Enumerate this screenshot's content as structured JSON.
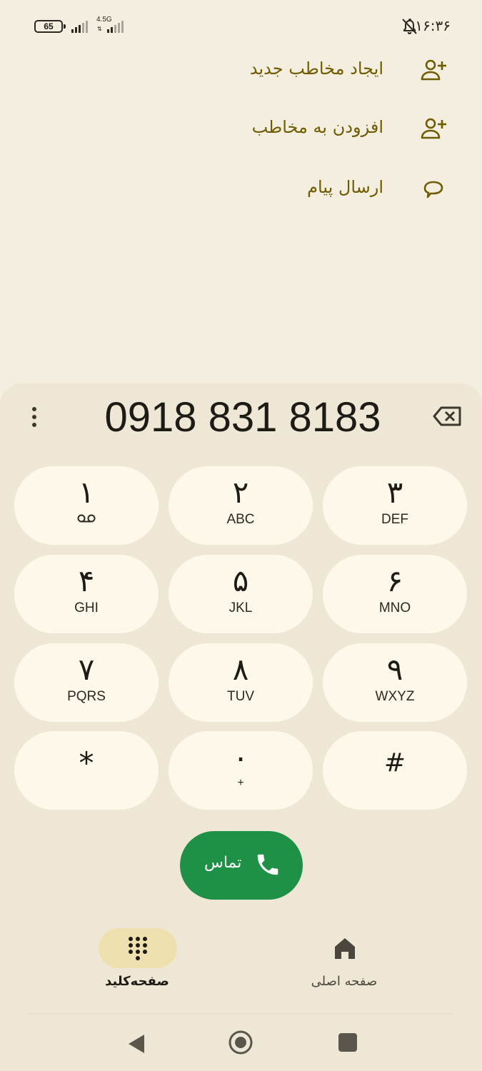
{
  "status_bar": {
    "battery": "65",
    "network": "4.5G",
    "time": "۱۶:۳۶",
    "icons": [
      "signal-icon",
      "signal-4g-icon",
      "bell-off-icon"
    ]
  },
  "actions": [
    {
      "label": "ایجاد مخاطب جدید",
      "icon": "person-add-icon"
    },
    {
      "label": "افزودن به مخاطب",
      "icon": "person-add-icon"
    },
    {
      "label": "ارسال پیام",
      "icon": "message-icon"
    }
  ],
  "dialer": {
    "number": "0918 831 8183"
  },
  "keys": [
    {
      "digit": "۱",
      "letters": ""
    },
    {
      "digit": "۲",
      "letters": "ABC"
    },
    {
      "digit": "۳",
      "letters": "DEF"
    },
    {
      "digit": "۴",
      "letters": "GHI"
    },
    {
      "digit": "۵",
      "letters": "JKL"
    },
    {
      "digit": "۶",
      "letters": "MNO"
    },
    {
      "digit": "۷",
      "letters": "PQRS"
    },
    {
      "digit": "۸",
      "letters": "TUV"
    },
    {
      "digit": "۹",
      "letters": "WXYZ"
    },
    {
      "digit": "*",
      "letters": ""
    },
    {
      "digit": "۰",
      "letters": "+"
    },
    {
      "digit": "#",
      "letters": ""
    }
  ],
  "call": {
    "label": "تماس"
  },
  "tabs": [
    {
      "label": "صفحه‌کلید",
      "selected": true
    },
    {
      "label": "صفحه اصلی",
      "selected": false
    }
  ],
  "colors": {
    "background": "#f3eedf",
    "sheet": "#efe7d6",
    "key": "#fdf8e9",
    "accent_text": "#6f5c00",
    "call_green": "#1f9146",
    "tab_selected": "#efe0b0"
  }
}
